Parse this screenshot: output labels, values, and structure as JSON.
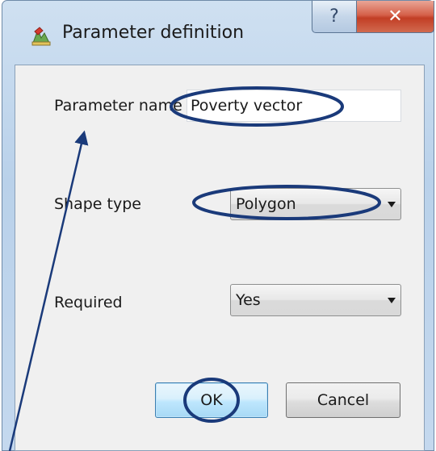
{
  "window": {
    "title": "Parameter definition",
    "help_glyph": "?",
    "close_glyph": "✕"
  },
  "form": {
    "parameter_name_label": "Parameter name",
    "parameter_name_value": "Poverty vector",
    "shape_type_label": "Shape type",
    "shape_type_value": "Polygon",
    "required_label": "Required",
    "required_value": "Yes"
  },
  "buttons": {
    "ok": "OK",
    "cancel": "Cancel"
  },
  "icons": {
    "app": "qgis-model-icon",
    "help": "question-mark-icon",
    "close": "close-icon",
    "dropdown": "chevron-down-icon"
  },
  "colors": {
    "annotation": "#1a3a7a",
    "close_button": "#c23e25",
    "ok_button_border": "#3c7fb1"
  }
}
